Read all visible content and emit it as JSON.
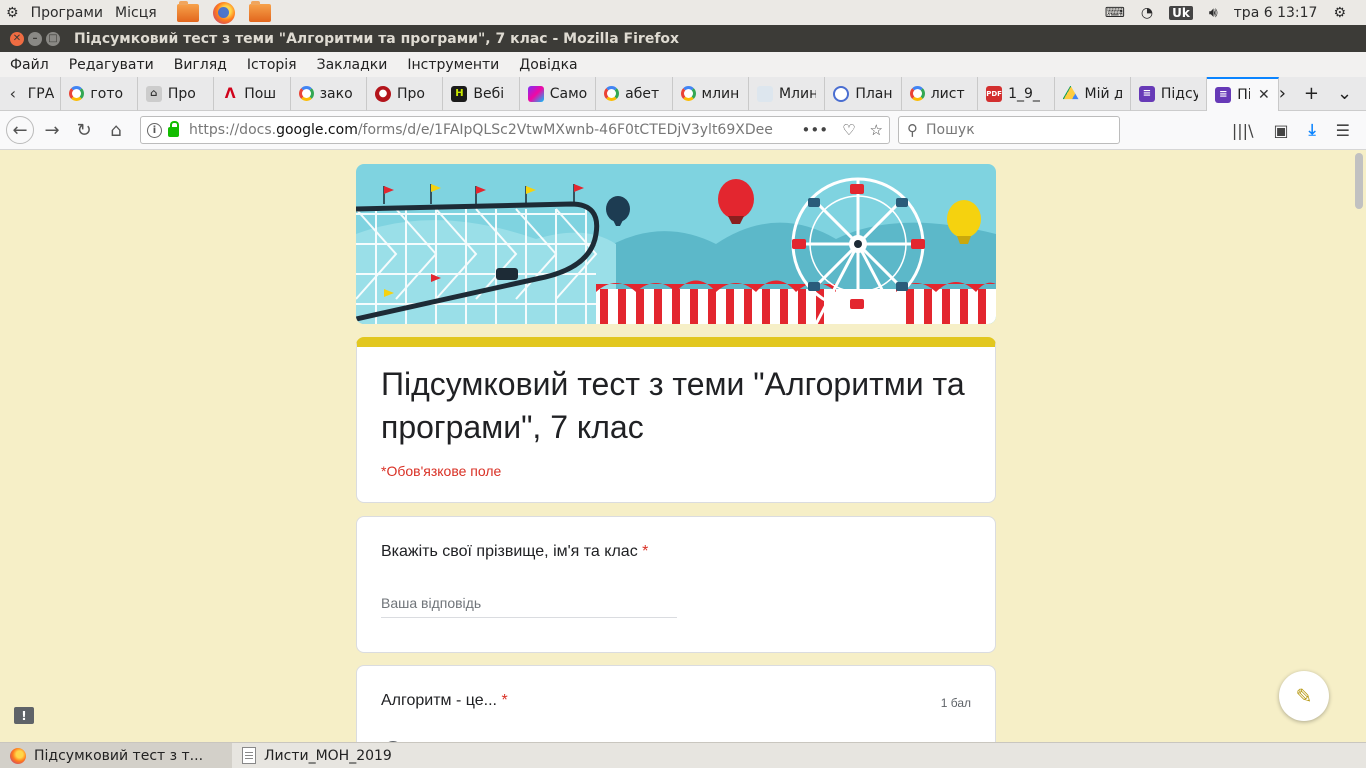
{
  "top_panel": {
    "apps_label": "Програми",
    "places_label": "Місця",
    "keyboard_layout": "Uk",
    "clock": "тра  6 13:17"
  },
  "window": {
    "title": "Підсумковий тест з теми \"Алгоритми та програми\", 7 клас - Mozilla Firefox"
  },
  "menu": [
    "Файл",
    "Редагувати",
    "Вигляд",
    "Історія",
    "Закладки",
    "Інструменти",
    "Довідка"
  ],
  "tabs": [
    {
      "label": "ГРА",
      "icon": "generic-icon"
    },
    {
      "label": "гото",
      "icon": "google-icon"
    },
    {
      "label": "Про",
      "icon": "building-icon"
    },
    {
      "label": "Пош",
      "icon": "red-a-icon"
    },
    {
      "label": "зако",
      "icon": "google-icon"
    },
    {
      "label": "Про",
      "icon": "red-circle-icon"
    },
    {
      "label": "Вебі",
      "icon": "h-icon"
    },
    {
      "label": "Само",
      "icon": "colorful-icon"
    },
    {
      "label": "абет",
      "icon": "google-icon"
    },
    {
      "label": "млин",
      "icon": "google-icon"
    },
    {
      "label": "Млин",
      "icon": "image-icon"
    },
    {
      "label": "План",
      "icon": "blue-circle-icon"
    },
    {
      "label": "лист",
      "icon": "google-icon"
    },
    {
      "label": "1_9_",
      "icon": "pdf-icon"
    },
    {
      "label": "Мій д",
      "icon": "drive-icon"
    },
    {
      "label": "Підсу",
      "icon": "forms-icon"
    },
    {
      "label": "Пі",
      "icon": "forms-icon",
      "active": true
    }
  ],
  "nav": {
    "url_prefix": "https://docs.",
    "url_domain": "google.com",
    "url_rest": "/forms/d/e/1FAIpQLSc2VtwMXwnb-46F0tCTEDjV3ylt69XDeek",
    "search_placeholder": "Пошук"
  },
  "form": {
    "title": "Підсумковий тест з теми \"Алгоритми та програми\", 7 клас",
    "required_note": "*Обов'язкове поле",
    "questions": [
      {
        "title": "Вкажіть свої прізвище, ім'я та клас",
        "required_mark": "*",
        "placeholder": "Ваша відповідь"
      },
      {
        "title": "Алгоритм - це...",
        "required_mark": "*",
        "points": "1 бал"
      }
    ],
    "theme_color": "#e2c71f"
  },
  "taskbar": [
    {
      "label": "Підсумковий тест з т...",
      "active": true
    },
    {
      "label": "Листи_МОН_2019",
      "active": false
    }
  ]
}
